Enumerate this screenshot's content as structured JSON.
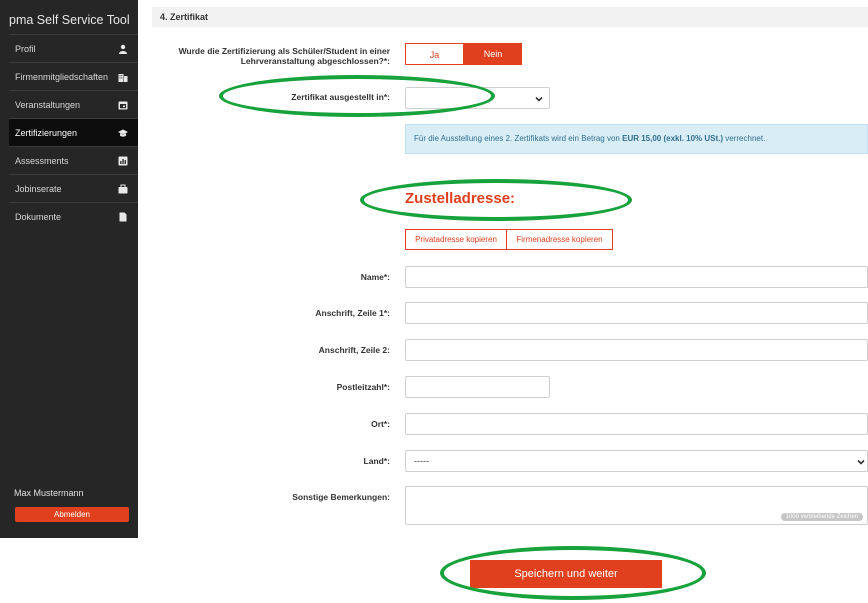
{
  "sidebar": {
    "brand": "pma Self Service Tool",
    "items": [
      {
        "label": "Profil",
        "icon": "user-icon"
      },
      {
        "label": "Firmenmitgliedschaften",
        "icon": "building-icon"
      },
      {
        "label": "Veranstaltungen",
        "icon": "calendar-icon"
      },
      {
        "label": "Zertifizierungen",
        "icon": "graduation-cap-icon",
        "active": true
      },
      {
        "label": "Assessments",
        "icon": "chart-icon"
      },
      {
        "label": "Jobinserate",
        "icon": "briefcase-icon"
      },
      {
        "label": "Dokumente",
        "icon": "document-icon"
      }
    ],
    "user_name": "Max Mustermann",
    "logout_label": "Abmelden"
  },
  "section": {
    "title": "4. Zertifikat"
  },
  "form": {
    "student_question_line1": "Wurde die Zertifizierung als Schüler/Student in einer",
    "student_question_line2": "Lehrveranstaltung abgeschlossen?*:",
    "yes_label": "Ja",
    "no_label": "Nein",
    "selected_option": "Nein",
    "certificate_issued_label": "Zertifikat ausgestellt in*:",
    "certificate_issued_value": "",
    "info_prefix": "Für die Ausstellung eines 2. Zertifikats wird ein Betrag von ",
    "info_amount": "EUR 15,00 (exkl. 10% USt.)",
    "info_suffix": " verrechnet.",
    "address_heading": "Zustelladresse:",
    "copy_private_label": "Privatadresse kopieren",
    "copy_company_label": "Firmenadresse kopieren",
    "name_label": "Name*:",
    "address1_label": "Anschrift, Zeile 1*:",
    "address2_label": "Anschrift, Zeile 2:",
    "zip_label": "Postleitzahl*:",
    "city_label": "Ort*:",
    "country_label": "Land*:",
    "country_value": "-----",
    "remarks_label": "Sonstige Bemerkungen:",
    "remarks_counter": "1000 verbleibende Zeichen",
    "save_label": "Speichern und weiter"
  },
  "colors": {
    "accent": "#e0401d",
    "sidebar_bg": "#262626",
    "highlight_ellipse": "#17a23b",
    "info_bg": "#d9edf7"
  }
}
